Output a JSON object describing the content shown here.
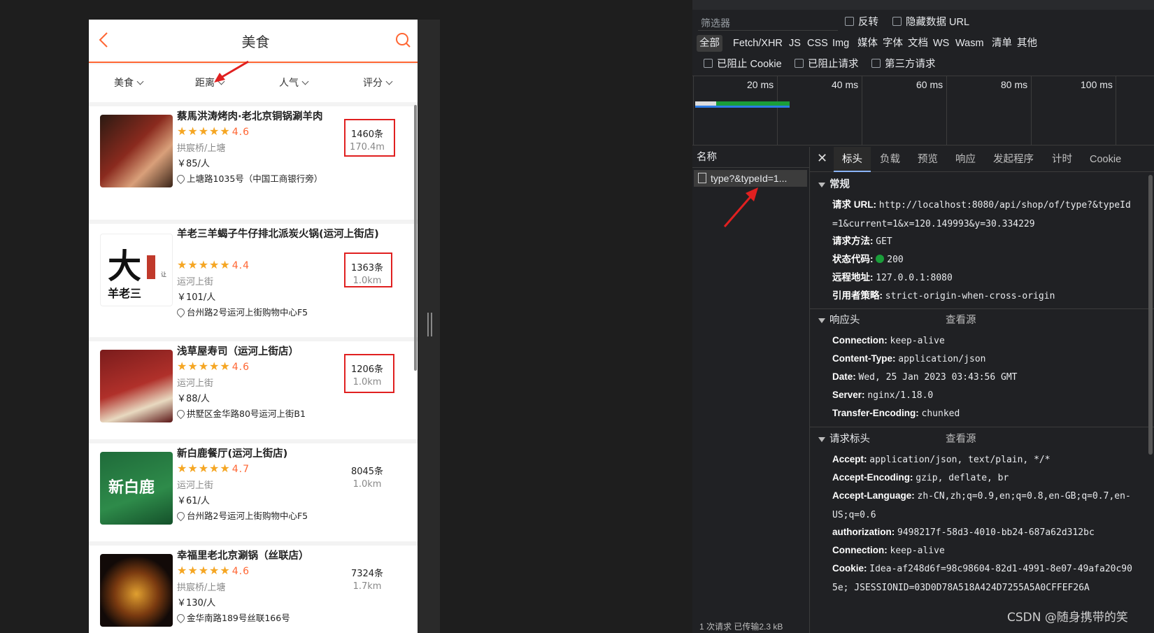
{
  "app": {
    "nav_title": "美食",
    "filters": [
      "美食",
      "距离",
      "人气",
      "评分"
    ]
  },
  "shops": [
    {
      "name": "蔡馬洪涛烤肉·老北京铜锅涮羊肉",
      "stars": "★★★★★",
      "score": "4.6",
      "area": "拱宸桥/上塘",
      "price": "￥85/人",
      "address": "上塘路1035号（中国工商银行旁）",
      "count": "1460条",
      "distance": "170.4m",
      "highlight": true
    },
    {
      "name": "羊老三羊蝎子牛仔排北派炭火锅(运河上街店)",
      "stars": "★★★★★",
      "score": "4.4",
      "area": "运河上街",
      "price": "￥101/人",
      "address": "台州路2号运河上街购物中心F5",
      "count": "1363条",
      "distance": "1.0km",
      "highlight": true
    },
    {
      "name": "浅草屋寿司（运河上街店）",
      "stars": "★★★★★",
      "score": "4.6",
      "area": "运河上街",
      "price": "￥88/人",
      "address": "拱墅区金华路80号运河上街B1",
      "count": "1206条",
      "distance": "1.0km",
      "highlight": true
    },
    {
      "name": "新白鹿餐厅(运河上街店)",
      "stars": "★★★★★",
      "score": "4.7",
      "area": "运河上街",
      "price": "￥61/人",
      "address": "台州路2号运河上街购物中心F5",
      "count": "8045条",
      "distance": "1.0km",
      "highlight": false
    },
    {
      "name": "幸福里老北京涮锅（丝联店）",
      "stars": "★★★★★",
      "score": "4.6",
      "area": "拱宸桥/上塘",
      "price": "￥130/人",
      "address": "金华南路189号丝联166号",
      "count": "7324条",
      "distance": "1.7km",
      "highlight": false
    }
  ],
  "devtools": {
    "filter_placeholder": "筛选器",
    "invert_label": "反转",
    "hide_data_url_label": "隐藏数据 URL",
    "types": [
      "全部",
      "Fetch/XHR",
      "JS",
      "CSS",
      "Img",
      "媒体",
      "字体",
      "文档",
      "WS",
      "Wasm",
      "清单",
      "其他"
    ],
    "blocked_cookie_label": "已阻止 Cookie",
    "blocked_request_label": "已阻止请求",
    "third_party_label": "第三方请求",
    "timeline_ticks": [
      "20 ms",
      "40 ms",
      "60 ms",
      "80 ms",
      "100 ms"
    ],
    "name_header": "名称",
    "request_name": "type?&typeId=1...",
    "status_footer": "1 次请求  已传输2.3 kB",
    "tabs": [
      "标头",
      "负载",
      "预览",
      "响应",
      "发起程序",
      "计时",
      "Cookie"
    ],
    "general": {
      "title": "常规",
      "request_url_label": "请求 URL:",
      "request_url": "http://localhost:8080/api/shop/of/type?&typeId=1&current=1&x=120.149993&y=30.334229",
      "method_label": "请求方法:",
      "method": "GET",
      "status_label": "状态代码:",
      "status": "200",
      "remote_label": "远程地址:",
      "remote": "127.0.0.1:8080",
      "referrer_label": "引用者策略:",
      "referrer": "strict-origin-when-cross-origin"
    },
    "response_headers": {
      "title": "响应头",
      "view_source": "查看源",
      "items": [
        {
          "k": "Connection:",
          "v": "keep-alive"
        },
        {
          "k": "Content-Type:",
          "v": "application/json"
        },
        {
          "k": "Date:",
          "v": "Wed, 25 Jan 2023 03:43:56 GMT"
        },
        {
          "k": "Server:",
          "v": "nginx/1.18.0"
        },
        {
          "k": "Transfer-Encoding:",
          "v": "chunked"
        }
      ]
    },
    "request_headers": {
      "title": "请求标头",
      "view_source": "查看源",
      "items": [
        {
          "k": "Accept:",
          "v": "application/json, text/plain, */*"
        },
        {
          "k": "Accept-Encoding:",
          "v": "gzip, deflate, br"
        },
        {
          "k": "Accept-Language:",
          "v": "zh-CN,zh;q=0.9,en;q=0.8,en-GB;q=0.7,en-US;q=0.6"
        },
        {
          "k": "authorization:",
          "v": "9498217f-58d3-4010-bb24-687a62d312bc"
        },
        {
          "k": "Connection:",
          "v": "keep-alive"
        },
        {
          "k": "Cookie:",
          "v": "Idea-af248d6f=98c98604-82d1-4991-8e07-49afa20c905e; JSESSIONID=03D0D78A518A424D7255A5A0CFFEF26A"
        }
      ]
    }
  },
  "watermark": "CSDN @随身携带的笑",
  "colors": {
    "accent": "#ff6633",
    "highlight_box": "#e02020",
    "star": "#f5a623"
  }
}
